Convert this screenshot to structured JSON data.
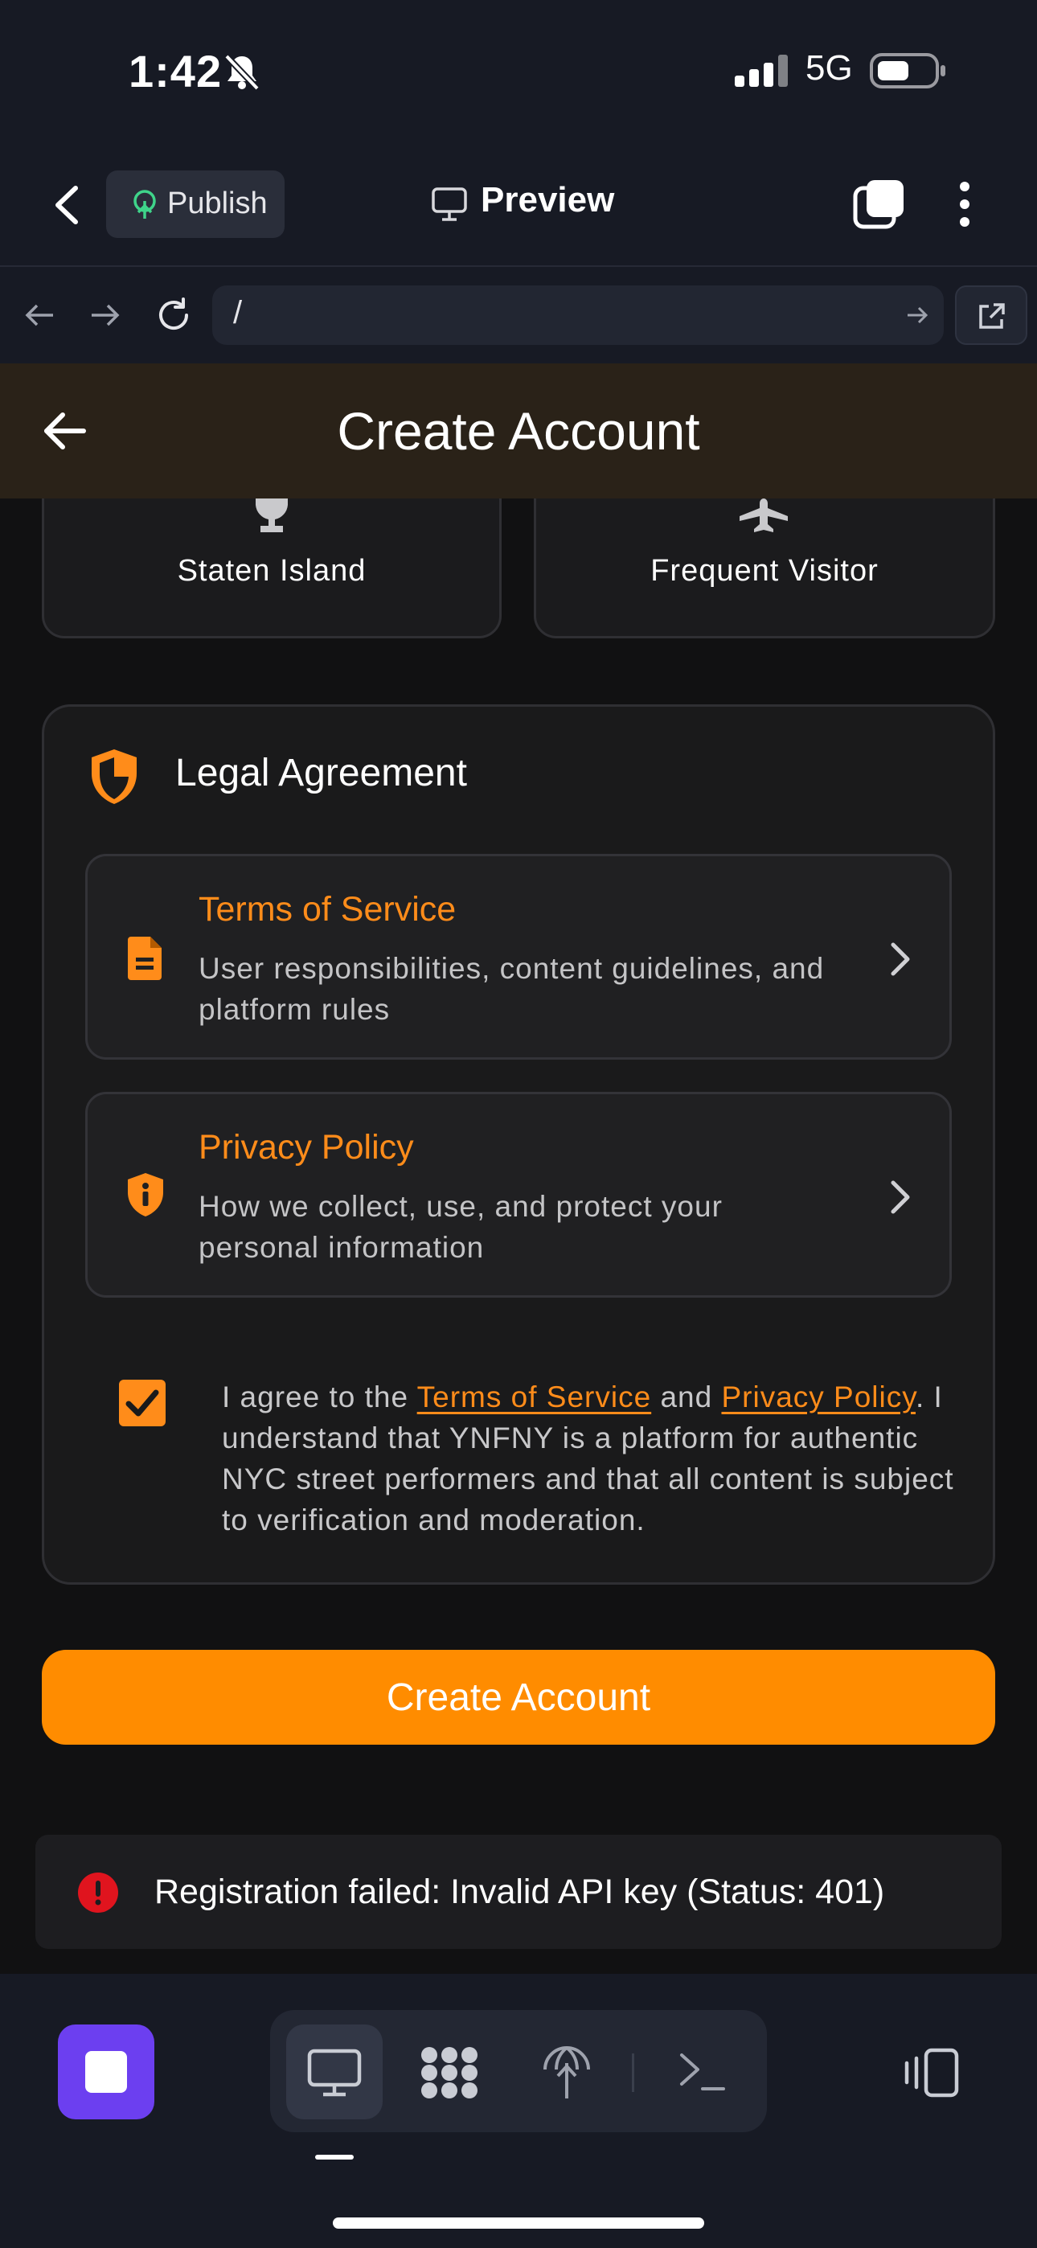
{
  "status_bar": {
    "time": "1:42",
    "network": "5G"
  },
  "app_bar": {
    "publish_label": "Publish",
    "preview_label": "Preview"
  },
  "url_bar": {
    "path": "/"
  },
  "page": {
    "title": "Create Account"
  },
  "tiles": [
    {
      "label": "Staten Island",
      "icon": "trophy-icon"
    },
    {
      "label": "Frequent Visitor",
      "icon": "airplane-icon"
    }
  ],
  "legal": {
    "heading": "Legal Agreement",
    "terms": {
      "title": "Terms of Service",
      "desc_line1": "User responsibilities, content guidelines, and",
      "desc_line2": "platform rules"
    },
    "privacy": {
      "title": "Privacy Policy",
      "desc_line1": "How we collect, use, and protect your",
      "desc_line2": "personal information"
    },
    "agree": {
      "checked": true,
      "prefix": "I agree to the ",
      "terms_link": "Terms of Service",
      "and": " and ",
      "privacy_link": "Privacy Policy",
      "suffix": ". I understand that YNFNY is a platform for authentic NYC street performers and that all content is subject to verification and moderation."
    }
  },
  "create_button_label": "Create Account",
  "error": {
    "message": "Registration failed: Invalid API key (Status: 401)"
  },
  "colors": {
    "accent": "#ff8c00",
    "error": "#e0141e",
    "stop": "#6c3ff0"
  }
}
